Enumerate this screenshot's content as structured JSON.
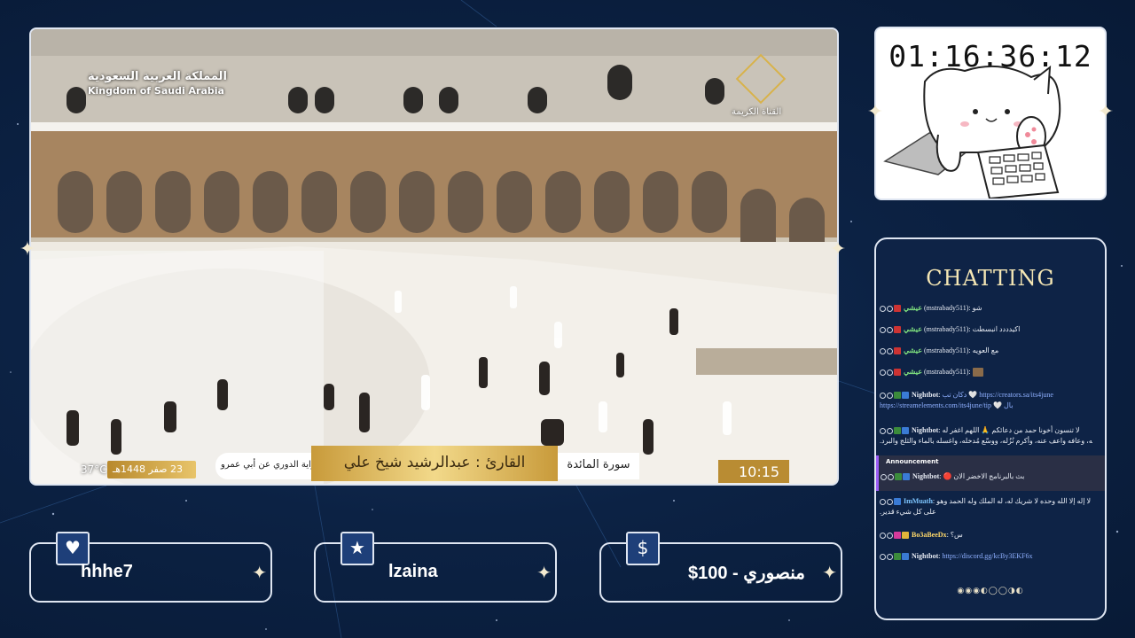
{
  "video": {
    "channel_ar": "المملكة العربية السعودية",
    "channel_en": "Kingdom of Saudi Arabia",
    "logo_text": "القناة الكريمة",
    "temperature": "37°C",
    "hijri_date": "23 صفر 1448هـ",
    "riwaya": "رواية الدوري عن أبي عمرو",
    "reciter": "القارئ : عبدالرشيد شيخ علي",
    "surah": "سورة المائدة",
    "clock": "10:15"
  },
  "timer": {
    "value": "01:16:36:12"
  },
  "chat": {
    "title": "CHATTING",
    "messages": [
      {
        "user": "عيشي",
        "handle": "(mstrabady511):",
        "text": "شو",
        "user_color": "#7ee07e"
      },
      {
        "user": "عيشي",
        "handle": "(mstrabady511):",
        "text": "اكيدددد انبسطت",
        "user_color": "#7ee07e"
      },
      {
        "user": "عيشي",
        "handle": "(mstrabady511):",
        "text": "مع العويه",
        "user_color": "#7ee07e"
      },
      {
        "user": "عيشي",
        "handle": "(mstrabady511):",
        "text": "",
        "user_color": "#7ee07e"
      },
      {
        "user": "Nightbot",
        "handle": ":",
        "text": "دكان تب 🤍 https://creators.sa/its4june",
        "line2": "https://streamelements.com/its4june/tip 🤍 بال",
        "user_color": "#ffffff"
      },
      {
        "user": "Nightbot",
        "handle": ":",
        "text": "لا تنسون أخونا حمد من دعائكم 🙏 اللهم اغفر له",
        "line2": "وارحمه، وعافه واعف عنه، وأكرم نُزُله، ووسّع مُدخله، واغسله بالماء والثلج والبرد.",
        "user_color": "#ffffff"
      },
      {
        "user": "Nightbot",
        "handle": ":",
        "text": "بث بالبرنامج الاخضر الان 🔴",
        "user_color": "#ffffff"
      },
      {
        "user": "ImMuath",
        "handle": ":",
        "text": "لا إله إلا الله وحده لا شريك له، له الملك وله الحمد وهو",
        "line2": "على كل شيء قدير.",
        "user_color": "#7ec6ff"
      },
      {
        "user": "Bo3aBeeDx",
        "handle": ":",
        "text": "س؟",
        "user_color": "#ffd96a"
      },
      {
        "user": "Nightbot",
        "handle": ":",
        "text": "https://discord.gg/kcBy3EKF6x",
        "user_color": "#ffffff"
      }
    ],
    "announcement_label": "Announcement",
    "moon_phases": "◉◉◉◐◯◯◑◐"
  },
  "panels": [
    {
      "icon": "heart-icon",
      "glyph": "♥",
      "name": "hhhe7"
    },
    {
      "icon": "star-icon",
      "glyph": "★",
      "name": "lzaina"
    },
    {
      "icon": "dollar-icon",
      "glyph": "$",
      "name": "منصوري - 100$"
    }
  ],
  "colors": {
    "background": "#0c2244",
    "frame": "#dfe6f2",
    "gold": "#f4e6b4",
    "badge": "#1e3f79"
  }
}
